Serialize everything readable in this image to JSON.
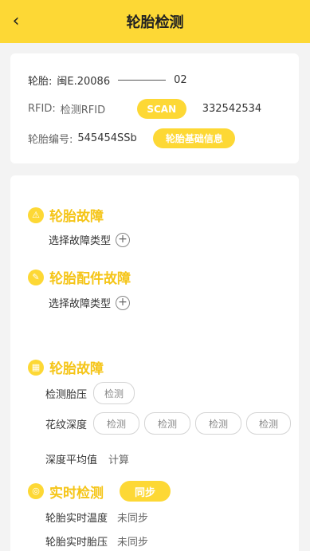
{
  "header": {
    "title": "轮胎检测",
    "back_icon": "‹"
  },
  "info": {
    "tire_label": "轮胎:",
    "tire_prefix": "闽E.20086",
    "tire_suffix": "02",
    "rfid_label": "RFID:",
    "rfid_placeholder": "检测RFID",
    "scan_label": "SCAN",
    "rfid_value": "332542534",
    "code_label": "轮胎编号:",
    "code_value": "545454SSb",
    "basic_info_button": "轮胎基础信息"
  },
  "sections": {
    "tire_fault": {
      "title": "轮胎故障",
      "select_label": "选择故障类型"
    },
    "parts_fault": {
      "title": "轮胎配件故障",
      "select_label": "选择故障类型"
    },
    "tire_detect": {
      "title": "轮胎故障",
      "pressure_label": "检测胎压",
      "pressure_button": "检测",
      "tread_label": "花纹深度",
      "tread_buttons": [
        "检测",
        "检测",
        "检测",
        "检测"
      ],
      "avg_label": "深度平均值",
      "avg_value": "计算"
    },
    "realtime": {
      "title": "实时检测",
      "sync_button": "同步",
      "temp_label": "轮胎实时温度",
      "temp_value": "未同步",
      "pressure_label": "轮胎实时胎压",
      "pressure_value": "未同步"
    }
  },
  "colors": {
    "accent": "#fdd835",
    "accent_text": "#f5c518"
  }
}
